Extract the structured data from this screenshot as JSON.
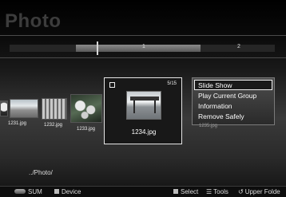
{
  "app": {
    "title": "Photo"
  },
  "timeline": {
    "pages": [
      "1",
      "2"
    ]
  },
  "thumbnails": [
    {
      "name": "1231.jpg"
    },
    {
      "name": "1232.jpg"
    },
    {
      "name": "1233.jpg"
    }
  ],
  "selected_item": {
    "name": "1234.jpg",
    "counter": "5/15"
  },
  "context_menu": {
    "items": [
      "Slide Show",
      "Play Current Group",
      "Information",
      "Remove Safely"
    ],
    "selected_index": 0
  },
  "behind_menu_caption": "1235.jpg",
  "path": "../Photo/",
  "bottom_bar": {
    "sum_label": "SUM",
    "device_label": "Device",
    "select_label": "Select",
    "tools_label": "Tools",
    "upper_folder_label": "Upper Folde"
  }
}
